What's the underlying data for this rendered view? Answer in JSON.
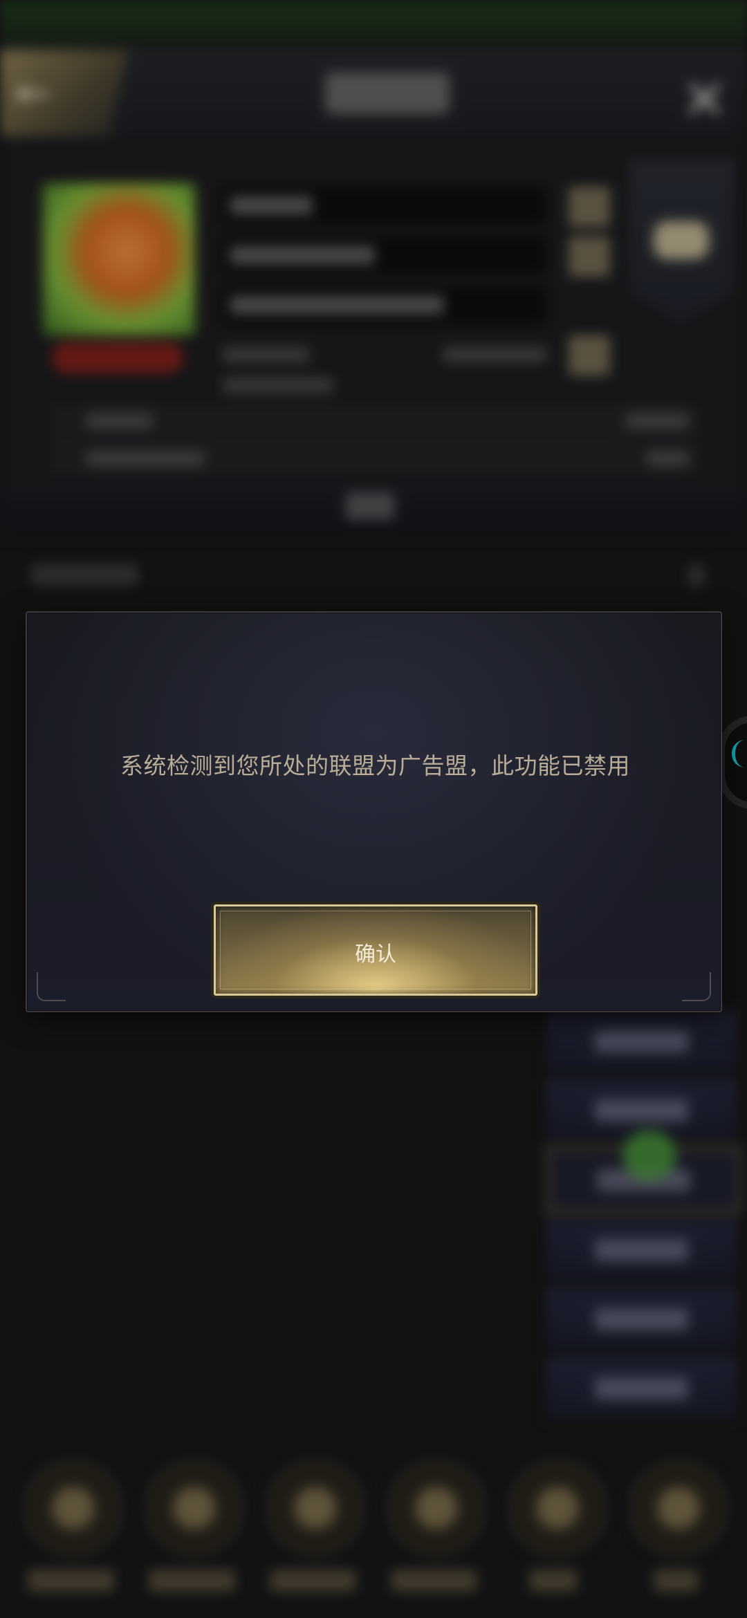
{
  "dialog": {
    "message": "系统检测到您所处的联盟为广告盟，此功能已禁用",
    "confirm_label": "确认"
  },
  "icons": {
    "back": "back-arrow-icon",
    "close": "close-icon"
  },
  "colors": {
    "dialog_text": "#b9ad97",
    "button_gold": "#8e7c4c",
    "accent_cyan": "#19c6d1"
  }
}
